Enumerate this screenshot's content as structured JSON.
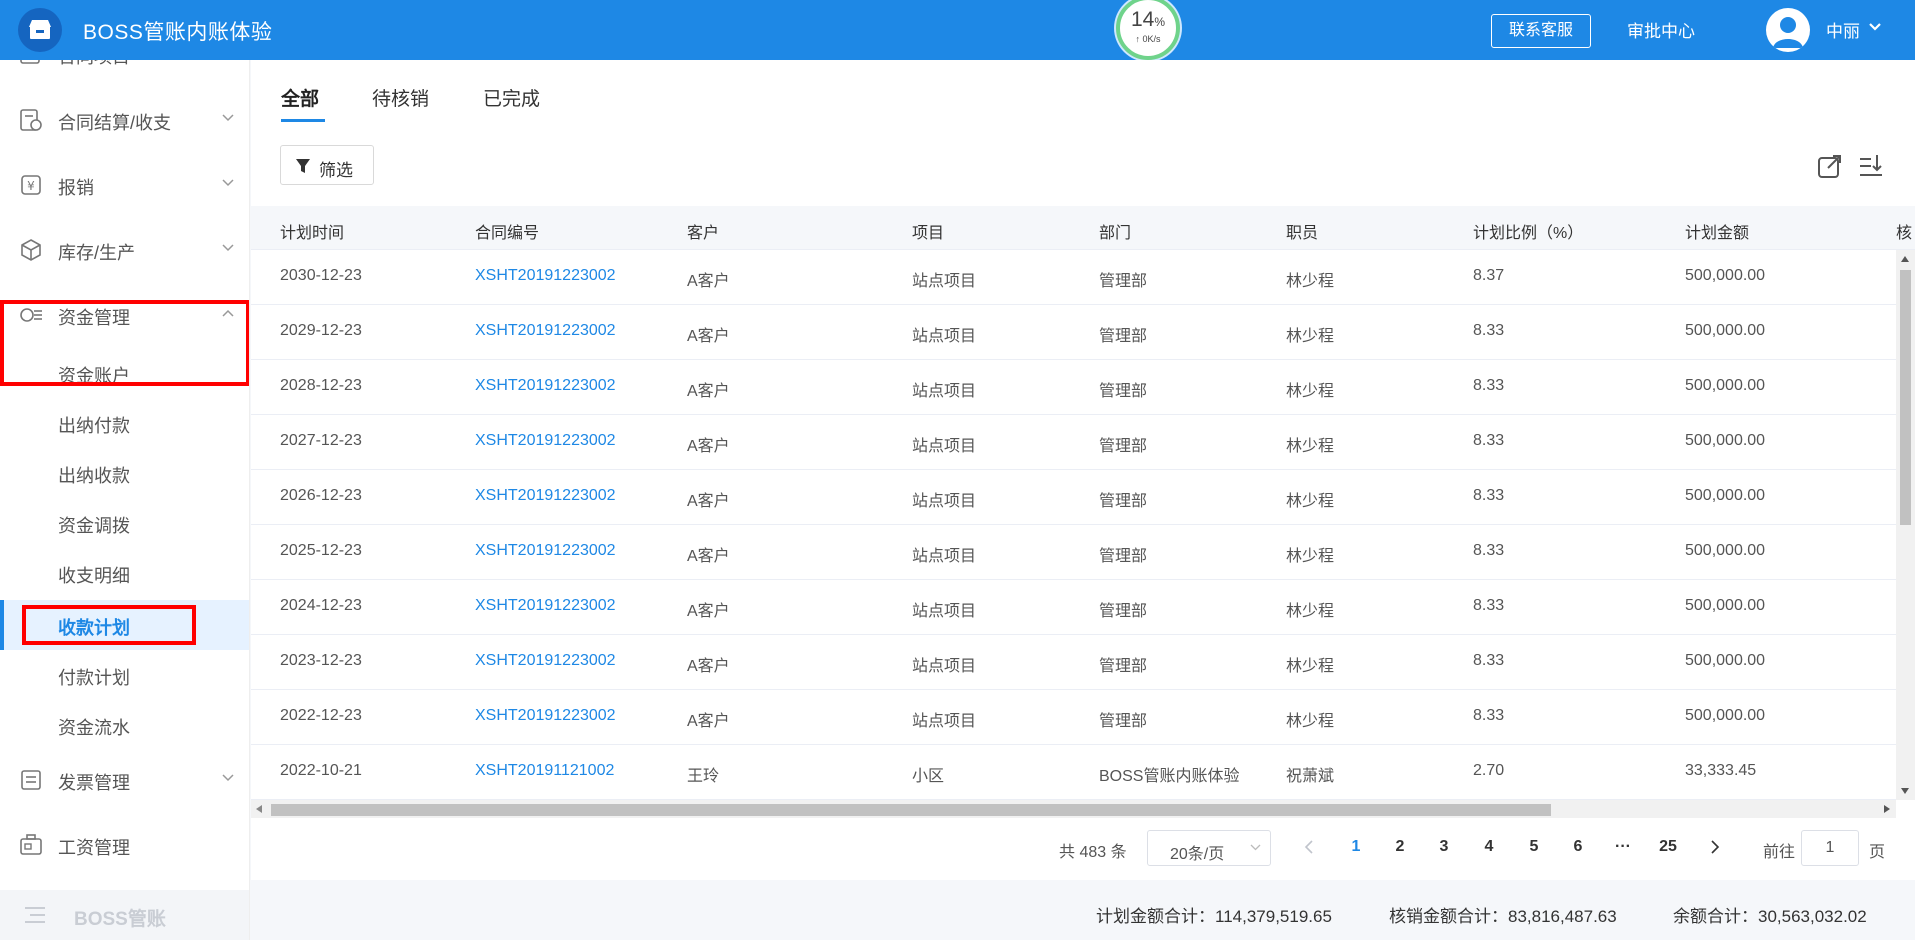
{
  "header": {
    "title": "BOSS管账内账体验",
    "speed_percent": "14",
    "speed_percent_unit": "%",
    "speed_rate": "↑ 0K/s",
    "contact_label": "联系客服",
    "approval_label": "审批中心",
    "username": "中丽",
    "colors": {
      "bar": "#1e88e5"
    }
  },
  "sidebar": {
    "top_partial_label": "合同项目",
    "groups": [
      {
        "label": "合同结算/收支",
        "icon": "contract-settle-icon"
      },
      {
        "label": "报销",
        "icon": "reimburse-icon"
      },
      {
        "label": "库存/生产",
        "icon": "inventory-box-icon"
      },
      {
        "label": "资金管理",
        "icon": "fund-icon",
        "expanded": true
      },
      {
        "label": "发票管理",
        "icon": "invoice-icon"
      },
      {
        "label": "工资管理",
        "icon": "salary-icon"
      }
    ],
    "fund_sub_items": [
      {
        "label": "资金账户"
      },
      {
        "label": "出纳付款"
      },
      {
        "label": "出纳收款"
      },
      {
        "label": "资金调拨"
      },
      {
        "label": "收支明细"
      },
      {
        "label": "收款计划",
        "active": true
      },
      {
        "label": "付款计划"
      },
      {
        "label": "资金流水"
      }
    ],
    "footer_label": "BOSS管账"
  },
  "tabs": [
    {
      "label": "全部",
      "active": true
    },
    {
      "label": "待核销"
    },
    {
      "label": "已完成"
    }
  ],
  "toolbar": {
    "filter_label": "筛选"
  },
  "table": {
    "columns": [
      "计划时间",
      "合同编号",
      "客户",
      "项目",
      "部门",
      "职员",
      "计划比例（%）",
      "计划金额",
      "核"
    ],
    "rows": [
      [
        "2030-12-23",
        "XSHT20191223002",
        "A客户",
        "站点项目",
        "管理部",
        "林少程",
        "8.37",
        "500,000.00"
      ],
      [
        "2029-12-23",
        "XSHT20191223002",
        "A客户",
        "站点项目",
        "管理部",
        "林少程",
        "8.33",
        "500,000.00"
      ],
      [
        "2028-12-23",
        "XSHT20191223002",
        "A客户",
        "站点项目",
        "管理部",
        "林少程",
        "8.33",
        "500,000.00"
      ],
      [
        "2027-12-23",
        "XSHT20191223002",
        "A客户",
        "站点项目",
        "管理部",
        "林少程",
        "8.33",
        "500,000.00"
      ],
      [
        "2026-12-23",
        "XSHT20191223002",
        "A客户",
        "站点项目",
        "管理部",
        "林少程",
        "8.33",
        "500,000.00"
      ],
      [
        "2025-12-23",
        "XSHT20191223002",
        "A客户",
        "站点项目",
        "管理部",
        "林少程",
        "8.33",
        "500,000.00"
      ],
      [
        "2024-12-23",
        "XSHT20191223002",
        "A客户",
        "站点项目",
        "管理部",
        "林少程",
        "8.33",
        "500,000.00"
      ],
      [
        "2023-12-23",
        "XSHT20191223002",
        "A客户",
        "站点项目",
        "管理部",
        "林少程",
        "8.33",
        "500,000.00"
      ],
      [
        "2022-12-23",
        "XSHT20191223002",
        "A客户",
        "站点项目",
        "管理部",
        "林少程",
        "8.33",
        "500,000.00"
      ],
      [
        "2022-10-21",
        "XSHT20191121002",
        "王玲",
        "小区",
        "BOSS管账内账体验",
        "祝萧斌",
        "2.70",
        "33,333.45"
      ]
    ]
  },
  "pagination": {
    "total": "共 483 条",
    "page_size": "20条/页",
    "pages": [
      "1",
      "2",
      "3",
      "4",
      "5",
      "6",
      "···",
      "25"
    ],
    "current": "1",
    "goto_label": "前往",
    "goto_value": "1",
    "page_unit": "页"
  },
  "summary": {
    "planned": "计划金额合计：114,379,519.65",
    "verified": "核销金额合计：83,816,487.63",
    "balance": "余额合计：30,563,032.02"
  }
}
